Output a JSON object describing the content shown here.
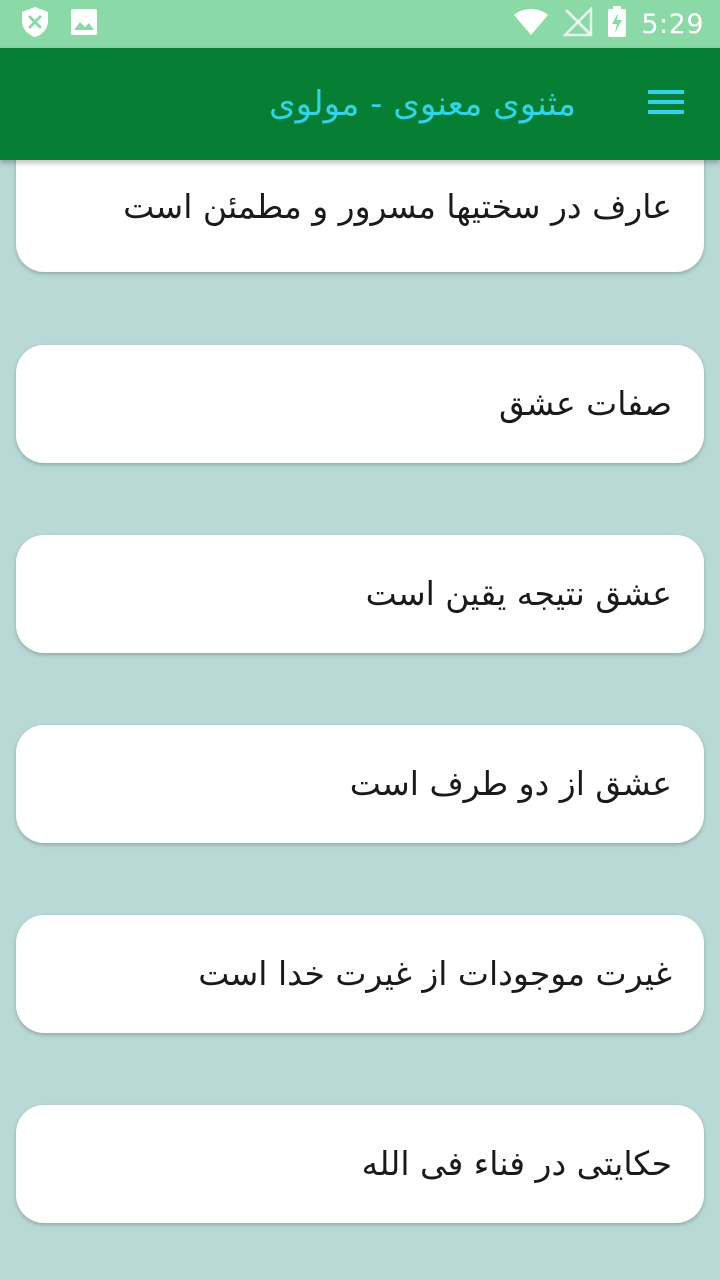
{
  "status_bar": {
    "time": "5:29",
    "icons_left": [
      "shield-x-icon",
      "image-icon"
    ],
    "icons_right": [
      "wifi-icon",
      "no-signal-icon",
      "battery-charging-icon"
    ]
  },
  "app_bar": {
    "title": "مثنوی معنوی - مولوی",
    "menu_icon": "hamburger-menu-icon"
  },
  "list_items": [
    {
      "label": "عارف در سختیها مسرور و مطمئن است"
    },
    {
      "label": "صفات عشق"
    },
    {
      "label": "عشق نتیجه یقین است"
    },
    {
      "label": "عشق از دو طرف است"
    },
    {
      "label": "غیرت موجودات از غیرت خدا است"
    },
    {
      "label": "حکایتی در فناء فی الله"
    }
  ],
  "colors": {
    "status_bar_bg": "#8ad9a7",
    "app_bar_bg": "#067f35",
    "title_color": "#30d3e8",
    "background": "#b9d9d7",
    "card_bg": "#ffffff"
  }
}
